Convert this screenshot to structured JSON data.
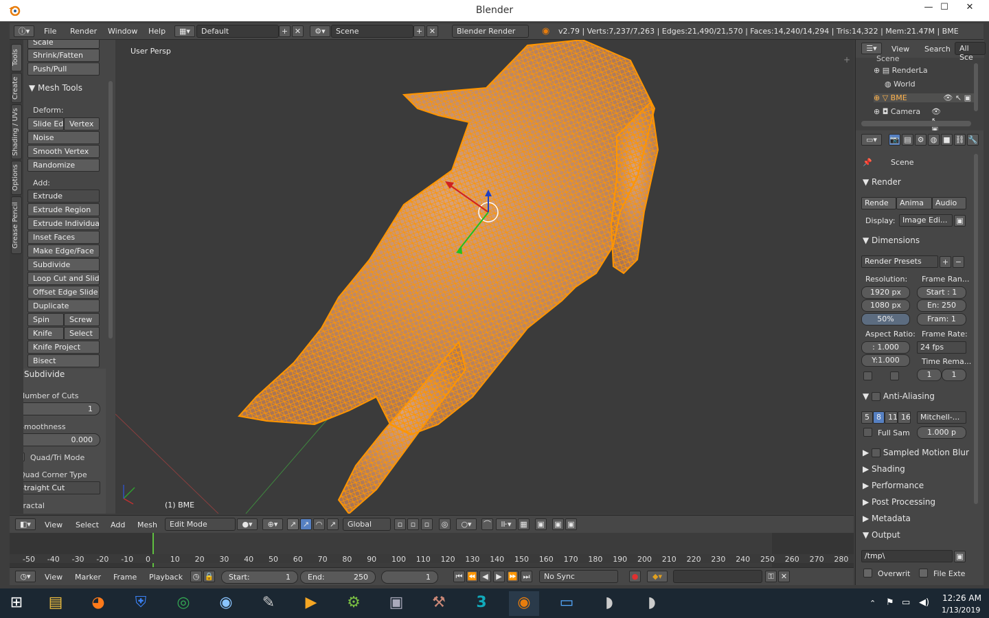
{
  "window": {
    "title": "Blender",
    "min": "—",
    "max": "☐",
    "close": "✕"
  },
  "infobar": {
    "menus": [
      "File",
      "Render",
      "Window",
      "Help"
    ],
    "layout": "Default",
    "scene": "Scene",
    "engine": "Blender Render",
    "stats": "v2.79 | Verts:7,237/7,263 | Edges:21,490/21,570 | Faces:14,240/14,294 | Tris:14,322 | Mem:21.47M | BME"
  },
  "tabs": [
    "Tools",
    "Create",
    "Shading / UVs",
    "Options",
    "Grease Pencil"
  ],
  "shelf": {
    "top_buttons": [
      "Scale",
      "Shrink/Fatten",
      "Push/Pull"
    ],
    "mesh_tools_title": "Mesh Tools",
    "deform_label": "Deform:",
    "deform": {
      "slide_edge": "Slide Ed",
      "vertex": "Vertex",
      "noise": "Noise",
      "smooth_vertex": "Smooth Vertex",
      "randomize": "Randomize"
    },
    "add_label": "Add:",
    "add": [
      "Extrude",
      "Extrude Region",
      "Extrude Individual",
      "Inset Faces",
      "Make Edge/Face",
      "Subdivide",
      "Loop Cut and Slide",
      "Offset Edge Slide",
      "Duplicate"
    ],
    "pairs": [
      [
        "Spin",
        "Screw"
      ],
      [
        "Knife",
        "Select"
      ]
    ],
    "knife_project": "Knife Project",
    "bisect": "Bisect",
    "subdivide_title": "Subdivide",
    "cuts_label": "Number of Cuts",
    "cuts": "1",
    "smooth_label": "Smoothness",
    "smooth": "0.000",
    "quadtri": "Quad/Tri Mode",
    "corner_label": "Quad Corner Type",
    "corner": "Straight Cut",
    "fractal": "Fractal"
  },
  "viewport": {
    "view_name": "User Persp",
    "object": "(1) BME"
  },
  "vpheader": {
    "menus": [
      "View",
      "Select",
      "Add",
      "Mesh"
    ],
    "mode": "Edit Mode",
    "orientation": "Global"
  },
  "timeline": {
    "ticks": [
      "-50",
      "-40",
      "-30",
      "-20",
      "-10",
      "0",
      "10",
      "20",
      "30",
      "40",
      "50",
      "60",
      "70",
      "80",
      "90",
      "100",
      "110",
      "120",
      "130",
      "140",
      "150",
      "160",
      "170",
      "180",
      "190",
      "200",
      "210",
      "220",
      "230",
      "240",
      "250",
      "260",
      "270",
      "280"
    ],
    "current_frame": 0
  },
  "tlheader": {
    "menus": [
      "View",
      "Marker",
      "Frame",
      "Playback"
    ],
    "start_label": "Start:",
    "start": "1",
    "end_label": "End:",
    "end": "250",
    "current": "1",
    "sync": "No Sync"
  },
  "outliner": {
    "view": "View",
    "search": "Search",
    "all": "All Sce",
    "items": [
      "Scene",
      "RenderLa",
      "World",
      "BME",
      "Camera"
    ]
  },
  "props": {
    "scene": "Scene",
    "render": "Render",
    "render_btns": [
      "Rende",
      "Anima",
      "Audio"
    ],
    "display_label": "Display:",
    "display": "Image Edi...",
    "dimensions": "Dimensions",
    "presets": "Render Presets",
    "resolution": "Resolution:",
    "res_x": "1920 px",
    "res_y": "1080 px",
    "res_pct": "50%",
    "frame_range": "Frame Ran...",
    "start": "Start : 1",
    "end": "En:  250",
    "frame": "Fram:  1",
    "aspect": "Aspect Ratio:",
    "asp_x": ":  1.000",
    "asp_y": "Y:1.000",
    "frame_rate": "Frame Rate:",
    "fps": "24 fps",
    "time_remap": "Time Rema...",
    "tr_a": "1",
    "tr_b": "1",
    "aa": "Anti-Aliasing",
    "aa_samples": [
      "5",
      "8",
      "11",
      "16"
    ],
    "aa_filter": "Mitchell-...",
    "full_sample": "Full Sam",
    "filter_size": "1.000 p",
    "motion_blur": "Sampled Motion Blur",
    "collapsed": [
      "Shading",
      "Performance",
      "Post Processing",
      "Metadata"
    ],
    "output": "Output",
    "out_path": "/tmp\\",
    "overwrite": "Overwrit",
    "file_ext": "File Exte"
  },
  "taskbar": {
    "time": "12:26 AM",
    "date": "1/13/2019"
  }
}
